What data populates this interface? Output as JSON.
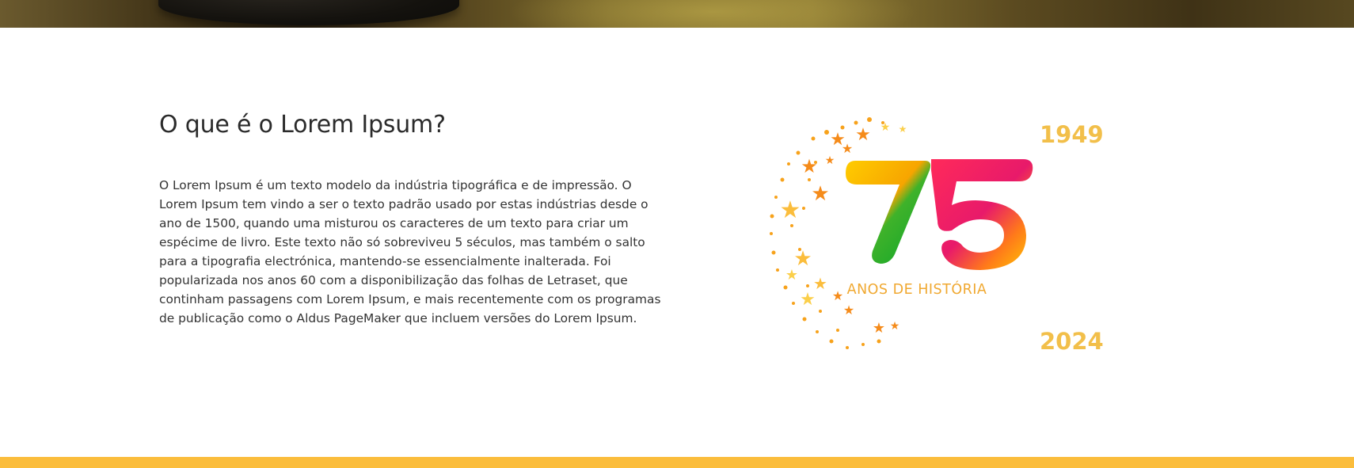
{
  "section": {
    "title": "O que é o Lorem Ipsum?",
    "body": "O Lorem Ipsum é um texto modelo da indústria tipográfica e de impressão. O Lorem Ipsum tem vindo a ser o texto padrão usado por estas indústrias desde o ano de 1500, quando uma misturou os caracteres de um texto para criar um espécime de livro. Este texto não só sobreviveu 5 séculos, mas também o salto para a tipografia electrónica, mantendo-se essencialmente inalterada. Foi popularizada nos anos 60 com a disponibilização das folhas de Letraset, que continham passagens com Lorem Ipsum, e mais recentemente com os programas de publicação como o Aldus PageMaker que incluem versões do Lorem Ipsum."
  },
  "anniversary_logo": {
    "number": "75",
    "caption": "ANOS DE HISTÓRIA",
    "year_start": "1949",
    "year_end": "2024",
    "icon": "stars-crescent-icon"
  },
  "colors": {
    "accent_yellow": "#fbbd3c",
    "year_gold": "#f2bf4a",
    "caption_orange": "#f0a830",
    "seven_green": "#16a526",
    "five_pink": "#e8195e"
  }
}
